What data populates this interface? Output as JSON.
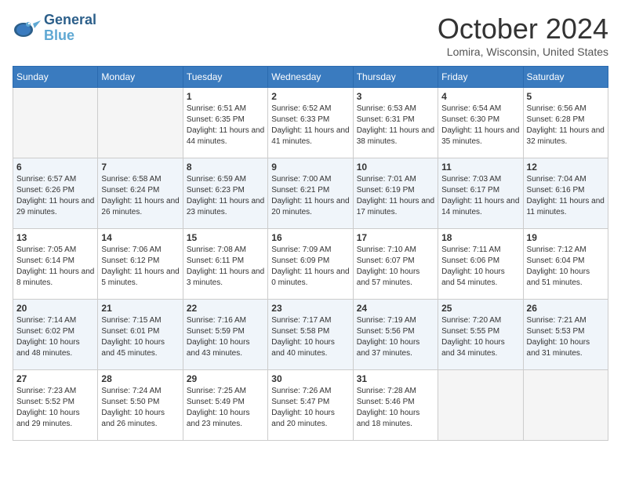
{
  "header": {
    "logo": {
      "general": "General",
      "blue": "Blue",
      "bird_unicode": "🐦"
    },
    "title": "October 2024",
    "location": "Lomira, Wisconsin, United States"
  },
  "weekdays": [
    "Sunday",
    "Monday",
    "Tuesday",
    "Wednesday",
    "Thursday",
    "Friday",
    "Saturday"
  ],
  "weeks": [
    [
      {
        "day": "",
        "sunrise": "",
        "sunset": "",
        "daylight": ""
      },
      {
        "day": "",
        "sunrise": "",
        "sunset": "",
        "daylight": ""
      },
      {
        "day": "1",
        "sunrise": "Sunrise: 6:51 AM",
        "sunset": "Sunset: 6:35 PM",
        "daylight": "Daylight: 11 hours and 44 minutes."
      },
      {
        "day": "2",
        "sunrise": "Sunrise: 6:52 AM",
        "sunset": "Sunset: 6:33 PM",
        "daylight": "Daylight: 11 hours and 41 minutes."
      },
      {
        "day": "3",
        "sunrise": "Sunrise: 6:53 AM",
        "sunset": "Sunset: 6:31 PM",
        "daylight": "Daylight: 11 hours and 38 minutes."
      },
      {
        "day": "4",
        "sunrise": "Sunrise: 6:54 AM",
        "sunset": "Sunset: 6:30 PM",
        "daylight": "Daylight: 11 hours and 35 minutes."
      },
      {
        "day": "5",
        "sunrise": "Sunrise: 6:56 AM",
        "sunset": "Sunset: 6:28 PM",
        "daylight": "Daylight: 11 hours and 32 minutes."
      }
    ],
    [
      {
        "day": "6",
        "sunrise": "Sunrise: 6:57 AM",
        "sunset": "Sunset: 6:26 PM",
        "daylight": "Daylight: 11 hours and 29 minutes."
      },
      {
        "day": "7",
        "sunrise": "Sunrise: 6:58 AM",
        "sunset": "Sunset: 6:24 PM",
        "daylight": "Daylight: 11 hours and 26 minutes."
      },
      {
        "day": "8",
        "sunrise": "Sunrise: 6:59 AM",
        "sunset": "Sunset: 6:23 PM",
        "daylight": "Daylight: 11 hours and 23 minutes."
      },
      {
        "day": "9",
        "sunrise": "Sunrise: 7:00 AM",
        "sunset": "Sunset: 6:21 PM",
        "daylight": "Daylight: 11 hours and 20 minutes."
      },
      {
        "day": "10",
        "sunrise": "Sunrise: 7:01 AM",
        "sunset": "Sunset: 6:19 PM",
        "daylight": "Daylight: 11 hours and 17 minutes."
      },
      {
        "day": "11",
        "sunrise": "Sunrise: 7:03 AM",
        "sunset": "Sunset: 6:17 PM",
        "daylight": "Daylight: 11 hours and 14 minutes."
      },
      {
        "day": "12",
        "sunrise": "Sunrise: 7:04 AM",
        "sunset": "Sunset: 6:16 PM",
        "daylight": "Daylight: 11 hours and 11 minutes."
      }
    ],
    [
      {
        "day": "13",
        "sunrise": "Sunrise: 7:05 AM",
        "sunset": "Sunset: 6:14 PM",
        "daylight": "Daylight: 11 hours and 8 minutes."
      },
      {
        "day": "14",
        "sunrise": "Sunrise: 7:06 AM",
        "sunset": "Sunset: 6:12 PM",
        "daylight": "Daylight: 11 hours and 5 minutes."
      },
      {
        "day": "15",
        "sunrise": "Sunrise: 7:08 AM",
        "sunset": "Sunset: 6:11 PM",
        "daylight": "Daylight: 11 hours and 3 minutes."
      },
      {
        "day": "16",
        "sunrise": "Sunrise: 7:09 AM",
        "sunset": "Sunset: 6:09 PM",
        "daylight": "Daylight: 11 hours and 0 minutes."
      },
      {
        "day": "17",
        "sunrise": "Sunrise: 7:10 AM",
        "sunset": "Sunset: 6:07 PM",
        "daylight": "Daylight: 10 hours and 57 minutes."
      },
      {
        "day": "18",
        "sunrise": "Sunrise: 7:11 AM",
        "sunset": "Sunset: 6:06 PM",
        "daylight": "Daylight: 10 hours and 54 minutes."
      },
      {
        "day": "19",
        "sunrise": "Sunrise: 7:12 AM",
        "sunset": "Sunset: 6:04 PM",
        "daylight": "Daylight: 10 hours and 51 minutes."
      }
    ],
    [
      {
        "day": "20",
        "sunrise": "Sunrise: 7:14 AM",
        "sunset": "Sunset: 6:02 PM",
        "daylight": "Daylight: 10 hours and 48 minutes."
      },
      {
        "day": "21",
        "sunrise": "Sunrise: 7:15 AM",
        "sunset": "Sunset: 6:01 PM",
        "daylight": "Daylight: 10 hours and 45 minutes."
      },
      {
        "day": "22",
        "sunrise": "Sunrise: 7:16 AM",
        "sunset": "Sunset: 5:59 PM",
        "daylight": "Daylight: 10 hours and 43 minutes."
      },
      {
        "day": "23",
        "sunrise": "Sunrise: 7:17 AM",
        "sunset": "Sunset: 5:58 PM",
        "daylight": "Daylight: 10 hours and 40 minutes."
      },
      {
        "day": "24",
        "sunrise": "Sunrise: 7:19 AM",
        "sunset": "Sunset: 5:56 PM",
        "daylight": "Daylight: 10 hours and 37 minutes."
      },
      {
        "day": "25",
        "sunrise": "Sunrise: 7:20 AM",
        "sunset": "Sunset: 5:55 PM",
        "daylight": "Daylight: 10 hours and 34 minutes."
      },
      {
        "day": "26",
        "sunrise": "Sunrise: 7:21 AM",
        "sunset": "Sunset: 5:53 PM",
        "daylight": "Daylight: 10 hours and 31 minutes."
      }
    ],
    [
      {
        "day": "27",
        "sunrise": "Sunrise: 7:23 AM",
        "sunset": "Sunset: 5:52 PM",
        "daylight": "Daylight: 10 hours and 29 minutes."
      },
      {
        "day": "28",
        "sunrise": "Sunrise: 7:24 AM",
        "sunset": "Sunset: 5:50 PM",
        "daylight": "Daylight: 10 hours and 26 minutes."
      },
      {
        "day": "29",
        "sunrise": "Sunrise: 7:25 AM",
        "sunset": "Sunset: 5:49 PM",
        "daylight": "Daylight: 10 hours and 23 minutes."
      },
      {
        "day": "30",
        "sunrise": "Sunrise: 7:26 AM",
        "sunset": "Sunset: 5:47 PM",
        "daylight": "Daylight: 10 hours and 20 minutes."
      },
      {
        "day": "31",
        "sunrise": "Sunrise: 7:28 AM",
        "sunset": "Sunset: 5:46 PM",
        "daylight": "Daylight: 10 hours and 18 minutes."
      },
      {
        "day": "",
        "sunrise": "",
        "sunset": "",
        "daylight": ""
      },
      {
        "day": "",
        "sunrise": "",
        "sunset": "",
        "daylight": ""
      }
    ]
  ]
}
